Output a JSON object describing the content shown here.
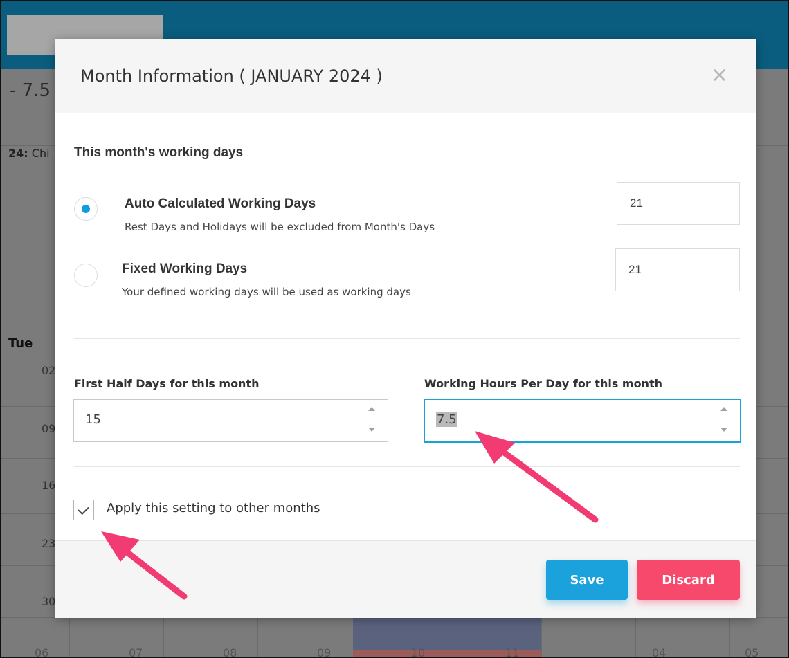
{
  "background": {
    "hours_fragment": "- 7.5",
    "holiday_label": "24:",
    "holiday_text": "Chi",
    "weekday": "Tue",
    "day_fragments": [
      "02",
      "09",
      "16",
      "23",
      "30"
    ],
    "bottom_row": [
      "06",
      "07",
      "08",
      "09",
      "10",
      "11",
      "04",
      "05"
    ]
  },
  "modal": {
    "title": "Month Information ( JANUARY 2024 )",
    "close_symbol": "×",
    "section_title": "This month's working days",
    "options": [
      {
        "title": "Auto Calculated Working Days",
        "description": "Rest Days and Holidays will be excluded from Month's Days",
        "value": "21",
        "selected": true
      },
      {
        "title": "Fixed Working Days",
        "description": "Your defined working days will be used as working days",
        "value": "21",
        "selected": false
      }
    ],
    "first_half": {
      "label": "First Half Days for this month",
      "value": "15"
    },
    "hours_per_day": {
      "label": "Working Hours Per Day for this month",
      "value": "7.5"
    },
    "apply_checkbox": {
      "label": "Apply this setting to other months",
      "checked": true
    },
    "buttons": {
      "save": "Save",
      "discard": "Discard"
    }
  },
  "colors": {
    "accent_blue": "#1ba2dd",
    "discard_red": "#f6496c",
    "annotation_arrow": "#f23b73"
  }
}
